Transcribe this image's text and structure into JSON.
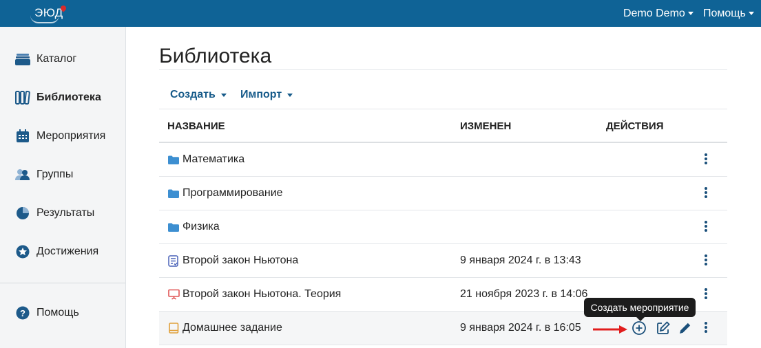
{
  "header": {
    "logo_text": "ЭЮД",
    "user_menu_label": "Demo Demo",
    "help_menu_label": "Помощь",
    "brand_color": "#0f6396"
  },
  "sidebar": {
    "items": [
      {
        "label": "Каталог",
        "icon": "catalog-tray-icon",
        "active": false
      },
      {
        "label": "Библиотека",
        "icon": "library-books-icon",
        "active": true
      },
      {
        "label": "Мероприятия",
        "icon": "calendar-icon",
        "active": false
      },
      {
        "label": "Группы",
        "icon": "users-icon",
        "active": false
      },
      {
        "label": "Результаты",
        "icon": "pie-chart-icon",
        "active": false
      },
      {
        "label": "Достижения",
        "icon": "star-badge-icon",
        "active": false
      }
    ],
    "help": {
      "label": "Помощь",
      "icon": "question-circle-icon"
    }
  },
  "main": {
    "title": "Библиотека",
    "toolbar": {
      "create_label": "Создать",
      "import_label": "Импорт"
    },
    "table": {
      "columns": [
        "НАЗВАНИЕ",
        "ИЗМЕНЕН",
        "ДЕЙСТВИЯ"
      ],
      "rows": [
        {
          "name": "Математика",
          "icon": "folder-icon",
          "modified": ""
        },
        {
          "name": "Программирование",
          "icon": "folder-icon",
          "modified": ""
        },
        {
          "name": "Физика",
          "icon": "folder-icon",
          "modified": ""
        },
        {
          "name": "Второй закон Ньютона",
          "icon": "test-checklist-icon",
          "modified": "9 января 2024 г. в 13:43"
        },
        {
          "name": "Второй закон Ньютона. Теория",
          "icon": "presentation-icon",
          "modified": "21 ноября 2023 г. в 14:06"
        },
        {
          "name": "Домашнее задание",
          "icon": "book-icon",
          "modified": "9 января 2024 г. в 16:05"
        }
      ]
    },
    "tooltip": "Создать мероприятие"
  },
  "colors": {
    "accent": "#175b8a",
    "folder": "#3d8fd1",
    "annotation_arrow": "#e11d1d"
  }
}
